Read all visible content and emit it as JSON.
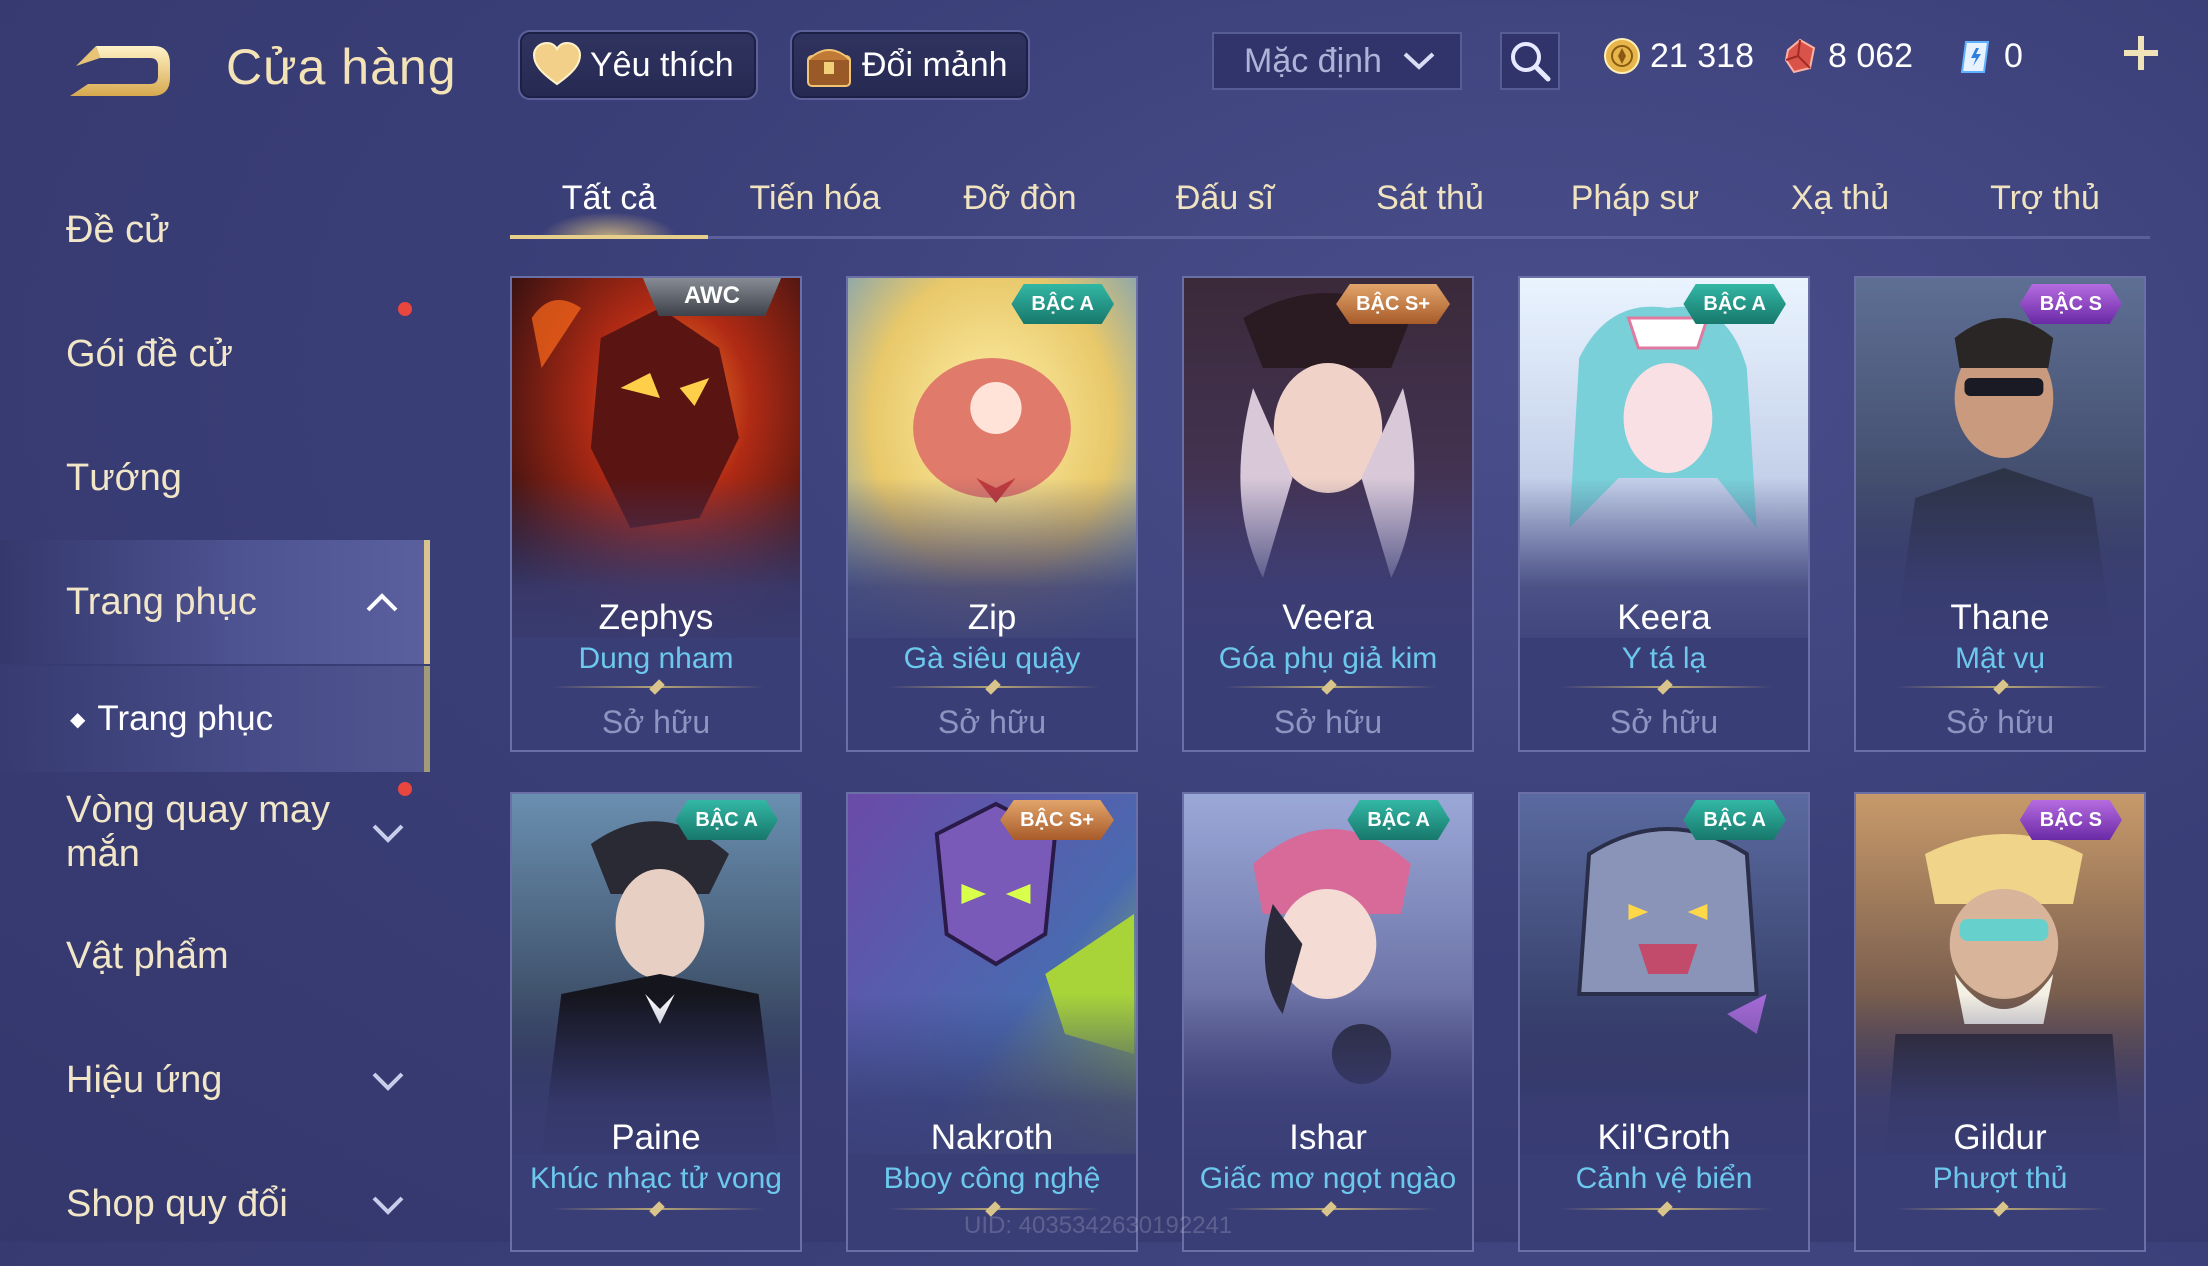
{
  "header": {
    "title": "Cửa hàng",
    "favorite_label": "Yêu thích",
    "exchange_label": "Đổi mảnh",
    "sort": {
      "selected": "Mặc định"
    },
    "currencies": [
      {
        "icon": "gold-coin-icon",
        "value": "21 318"
      },
      {
        "icon": "red-gem-icon",
        "value": "8 062"
      },
      {
        "icon": "blue-voucher-icon",
        "value": "0"
      }
    ]
  },
  "sidebar": {
    "items": [
      {
        "label": "Đề cử"
      },
      {
        "label": "Gói đề cử"
      },
      {
        "label": "Tướng"
      },
      {
        "label": "Trang phục"
      },
      {
        "label": "Trang phục"
      },
      {
        "label": "Vòng quay may mắn"
      },
      {
        "label": "Vật phẩm"
      },
      {
        "label": "Hiệu ứng"
      },
      {
        "label": "Shop quy đổi"
      }
    ]
  },
  "tabs": [
    "Tất cả",
    "Tiến hóa",
    "Đỡ đòn",
    "Đấu sĩ",
    "Sát thủ",
    "Pháp sư",
    "Xạ thủ",
    "Trợ thủ"
  ],
  "cards": [
    {
      "hero": "Zephys",
      "skin": "Dung nham",
      "badge": "AWC",
      "status": "Sở hữu"
    },
    {
      "hero": "Zip",
      "skin": "Gà siêu quậy",
      "badge": "BẬC A",
      "status": "Sở hữu"
    },
    {
      "hero": "Veera",
      "skin": "Góa phụ giả kim",
      "badge": "BẬC S+",
      "status": "Sở hữu"
    },
    {
      "hero": "Keera",
      "skin": "Y tá lạ",
      "badge": "BẬC A",
      "status": "Sở hữu"
    },
    {
      "hero": "Thane",
      "skin": "Mật vụ",
      "badge": "BẬC S",
      "status": "Sở hữu"
    },
    {
      "hero": "Paine",
      "skin": "Khúc nhạc tử vong",
      "badge": "BẬC A"
    },
    {
      "hero": "Nakroth",
      "skin": "Bboy công nghệ",
      "badge": "BẬC S+"
    },
    {
      "hero": "Ishar",
      "skin": "Giấc mơ ngọt ngào",
      "badge": "BẬC A"
    },
    {
      "hero": "Kil'Groth",
      "skin": "Cảnh vệ biển",
      "badge": "BẬC A"
    },
    {
      "hero": "Gildur",
      "skin": "Phượt thủ",
      "badge": "BẬC S"
    }
  ],
  "footer": {
    "uid": "UID: 4035342630192241"
  }
}
